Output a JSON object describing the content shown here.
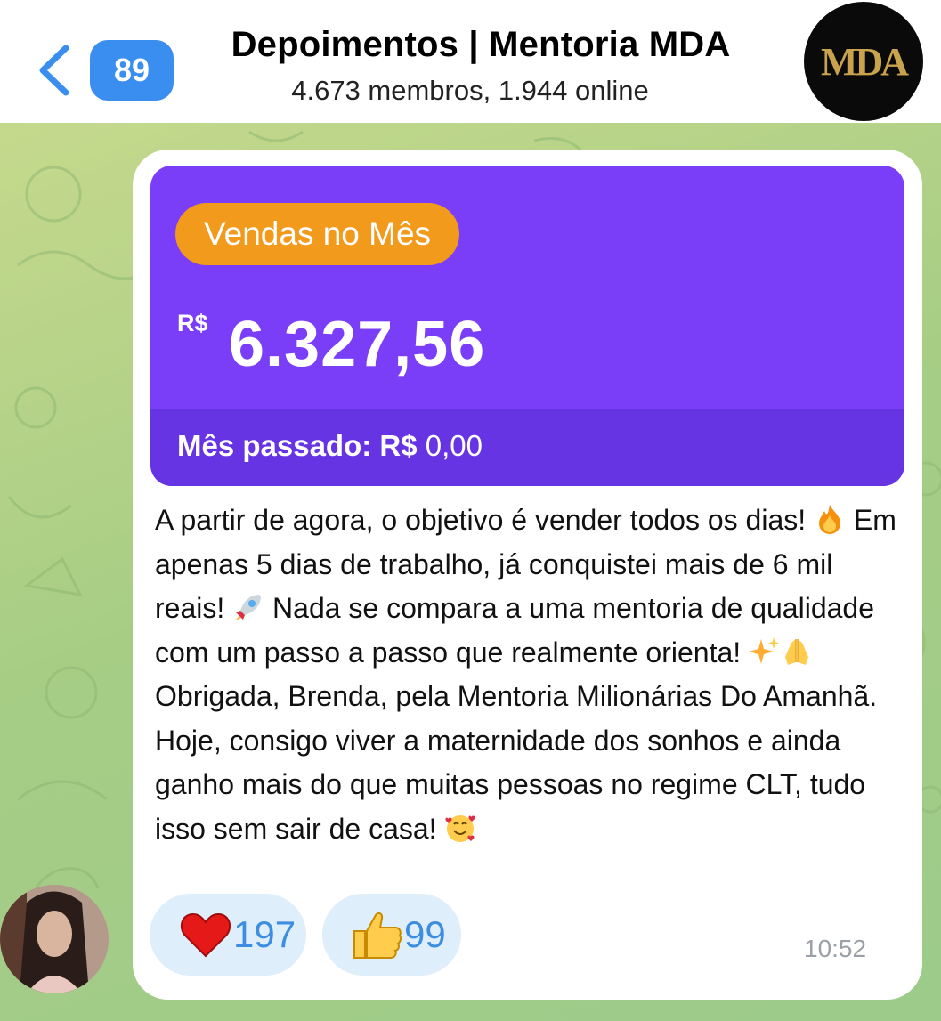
{
  "header": {
    "back_icon": "chevron-left-icon",
    "unread_count": "89",
    "title": "Depoimentos | Mentoria MDA",
    "subtitle": "4.673 membros, 1.944 online",
    "group_avatar_text": "MDA"
  },
  "message": {
    "card": {
      "badge": "Vendas no Mês",
      "currency": "R$",
      "amount": "6.327,56",
      "last_month_label": "Mês passado: R$",
      "last_month_value": "0,00"
    },
    "text_segments": {
      "s1": "A partir de agora, o objetivo é vender todos os dias! ",
      "s2": " Em apenas 5 dias de trabalho, já conquistei mais de 6 mil reais! ",
      "s3": " Nada se compara a uma mentoria de qualidade com um passo a passo que realmente orienta! ",
      "s4": " Obrigada, Brenda, pela Mentoria Milionárias Do Amanhã. Hoje, consigo viver a maternidade dos sonhos e ainda ganho mais do que muitas pessoas no regime CLT, tudo isso sem sair de casa! "
    },
    "emojis": [
      "fire",
      "rocket",
      "sparkles",
      "folded-hands",
      "smiling-face-with-hearts"
    ],
    "reactions": [
      {
        "icon": "heart-icon",
        "count": "197"
      },
      {
        "icon": "thumbs-up-icon",
        "count": "99"
      }
    ],
    "time": "10:52"
  },
  "colors": {
    "card_purple": "#7a3ef9",
    "card_footer_purple": "#6634e2",
    "badge_orange": "#f29a1c",
    "link_blue": "#3a8ef0",
    "reaction_bg": "#dfeefb"
  }
}
